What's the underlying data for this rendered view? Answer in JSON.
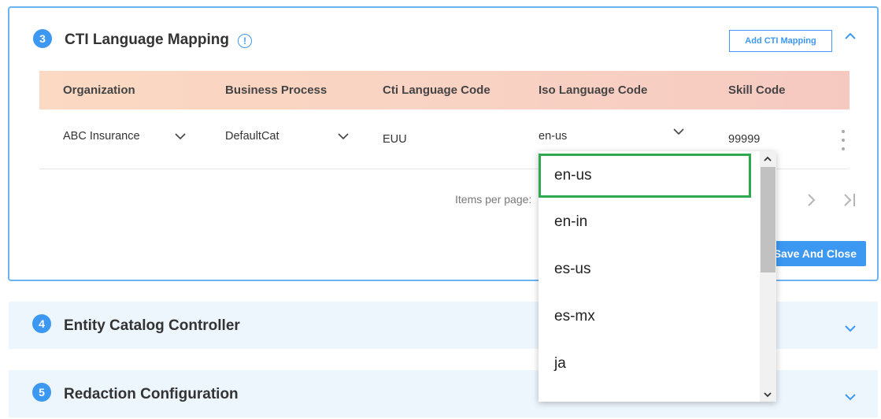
{
  "cti_section": {
    "step": "3",
    "title": "CTI Language Mapping",
    "info_glyph": "!",
    "add_button": "Add CTI Mapping",
    "columns": [
      "Organization",
      "Business Process",
      "Cti Language Code",
      "Iso Language Code",
      "Skill Code"
    ],
    "row": {
      "organization": "ABC Insurance",
      "business_process": "DefaultCat",
      "cti_language_code": "EUU",
      "iso_language_code": "en-us",
      "skill_code": "99999"
    },
    "items_per_page_label": "Items per page:",
    "save_button": "Save And Close"
  },
  "iso_dropdown": {
    "selected": "en-us",
    "options": [
      "en-us",
      "en-in",
      "es-us",
      "es-mx",
      "ja"
    ]
  },
  "collapsed_sections": [
    {
      "step": "4",
      "title": "Entity Catalog Controller"
    },
    {
      "step": "5",
      "title": "Redaction Configuration"
    }
  ],
  "colors": {
    "accent": "#3d98f2",
    "header_gradient_start": "#fbd9c2",
    "header_gradient_end": "#f6c9c0",
    "selected_outline": "#2fa84f",
    "collapsed_bg": "#edf5fd"
  }
}
